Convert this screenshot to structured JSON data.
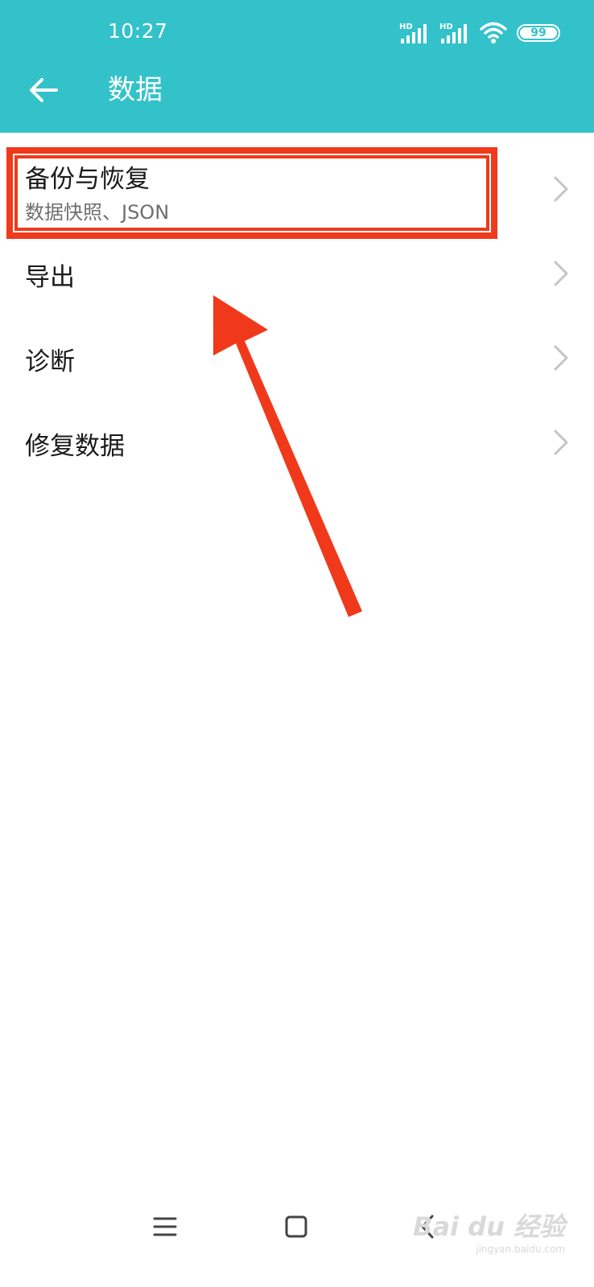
{
  "status_bar": {
    "time": "10:27",
    "signal1_label": "HD",
    "signal2_label": "HD",
    "battery": "99"
  },
  "header": {
    "title": "数据",
    "back_icon": "arrow-left-icon"
  },
  "list": {
    "items": [
      {
        "title": "备份与恢复",
        "subtitle": "数据快照、JSON"
      },
      {
        "title": "导出"
      },
      {
        "title": "诊断"
      },
      {
        "title": "修复数据"
      }
    ]
  },
  "annotation": {
    "box_color": "#ef3a1c",
    "arrow_color": "#f0391b"
  },
  "nav_bar": {
    "menu_icon": "menu-icon",
    "home_icon": "home-square-icon",
    "back_icon": "back-chevron-icon"
  },
  "watermark": {
    "brand": "Bai du 经验",
    "url": "jingyan.baidu.com"
  },
  "colors": {
    "accent": "#33c2c9"
  }
}
